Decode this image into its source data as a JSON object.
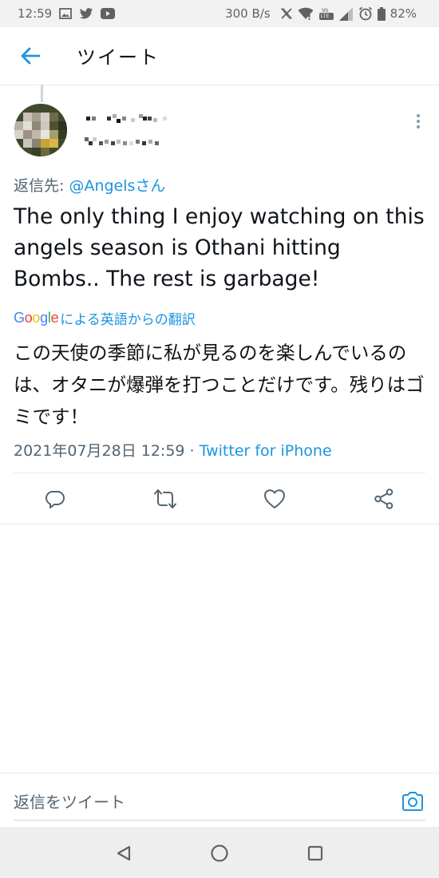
{
  "status_bar": {
    "time": "12:59",
    "network_speed": "300 B/s",
    "battery": "82%",
    "icons": [
      "image-icon",
      "twitter-icon",
      "youtube-icon",
      "x-icon",
      "wifi-icon",
      "volte-icon",
      "signal-icon",
      "alarm-icon",
      "battery-icon"
    ],
    "volte_label": "LTE"
  },
  "header": {
    "title": "ツイート"
  },
  "tweet": {
    "reply_prefix": "返信先: ",
    "reply_mention": "@Angelsさん",
    "text": "The only thing I enjoy watching on this angels season is Othani hitting Bombs.. The rest is garbage!",
    "translation": {
      "google_logo": "Google",
      "label": "による英語からの翻訳",
      "text": "この天使の季節に私が見るのを楽しんでいるのは、オタニが爆弾を打つことだけです。残りはゴミです！"
    },
    "timestamp": "2021年07月28日 12:59",
    "separator": " · ",
    "source": "Twitter for iPhone"
  },
  "composer": {
    "placeholder": "返信をツイート"
  },
  "colors": {
    "accent": "#1b95e0",
    "secondary_text": "#536471"
  }
}
